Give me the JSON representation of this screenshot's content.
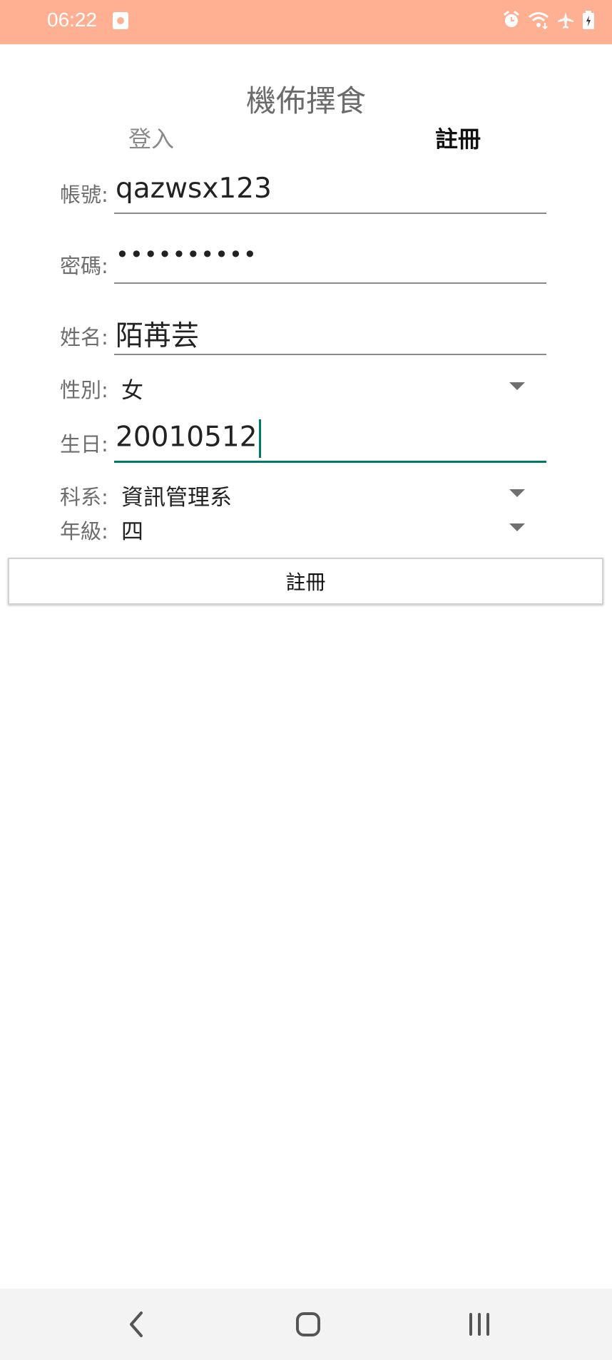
{
  "status_bar": {
    "time": "06:22",
    "icons": [
      "notification-icon",
      "alarm-icon",
      "wifi-icon",
      "airplane-icon",
      "battery-charging-icon"
    ]
  },
  "app": {
    "title": "機佈擇食"
  },
  "tabs": {
    "login": "登入",
    "register": "註冊",
    "active": "register"
  },
  "form": {
    "account": {
      "label": "帳號:",
      "value": "qazwsx123"
    },
    "password": {
      "label": "密碼:",
      "value": "••••••••••"
    },
    "name": {
      "label": "姓名:",
      "value": "陌苒芸"
    },
    "gender": {
      "label": "性別:",
      "value": "女"
    },
    "birthday": {
      "label": "生日:",
      "value": "20010512"
    },
    "department": {
      "label": "科系:",
      "value": "資訊管理系"
    },
    "grade": {
      "label": "年級:",
      "value": "四"
    }
  },
  "register_button": {
    "label": "註冊"
  },
  "colors": {
    "status_bar": "#ffb093",
    "accent": "#00796b"
  },
  "navigation": {
    "icons": [
      "back-icon",
      "home-icon",
      "recent-apps-icon"
    ]
  }
}
